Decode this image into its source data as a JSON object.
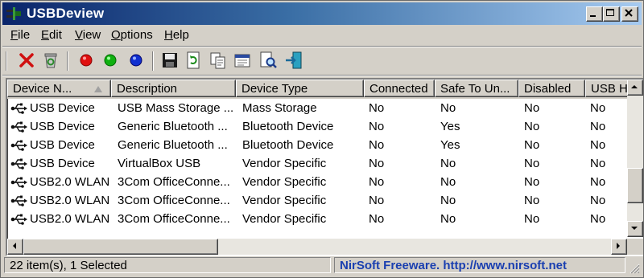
{
  "window": {
    "title": "USBDeview"
  },
  "menu": [
    {
      "key": "F",
      "rest": "ile"
    },
    {
      "key": "E",
      "rest": "dit"
    },
    {
      "key": "V",
      "rest": "iew"
    },
    {
      "key": "O",
      "rest": "ptions"
    },
    {
      "key": "H",
      "rest": "elp"
    }
  ],
  "toolbar": {
    "icons": [
      "delete-icon",
      "recycle-icon",
      "red-dot-icon",
      "green-dot-icon",
      "blue-dot-icon",
      "save-icon",
      "refresh-icon",
      "copy-icon",
      "properties-icon",
      "find-icon",
      "exit-icon"
    ],
    "colors": {
      "red": "#e01010",
      "green": "#10b010",
      "blue": "#1030d0"
    }
  },
  "table": {
    "columns": [
      "Device N...",
      "Description",
      "Device Type",
      "Connected",
      "Safe To Un...",
      "Disabled",
      "USB H"
    ],
    "rows": [
      [
        "USB Device",
        "USB Mass Storage ...",
        "Mass Storage",
        "No",
        "No",
        "No",
        "No"
      ],
      [
        "USB Device",
        "Generic Bluetooth ...",
        "Bluetooth Device",
        "No",
        "Yes",
        "No",
        "No"
      ],
      [
        "USB Device",
        "Generic Bluetooth ...",
        "Bluetooth Device",
        "No",
        "Yes",
        "No",
        "No"
      ],
      [
        "USB Device",
        "VirtualBox USB",
        "Vendor Specific",
        "No",
        "No",
        "No",
        "No"
      ],
      [
        "USB2.0 WLAN",
        "3Com OfficeConne...",
        "Vendor Specific",
        "No",
        "No",
        "No",
        "No"
      ],
      [
        "USB2.0 WLAN",
        "3Com OfficeConne...",
        "Vendor Specific",
        "No",
        "No",
        "No",
        "No"
      ],
      [
        "USB2.0 WLAN",
        "3Com OfficeConne...",
        "Vendor Specific",
        "No",
        "No",
        "No",
        "No"
      ]
    ]
  },
  "status": {
    "count": "22 item(s), 1 Selected",
    "vendor": "NirSoft Freeware.  http://www.nirsoft.net",
    "vendor_color": "#1a3fb0"
  }
}
